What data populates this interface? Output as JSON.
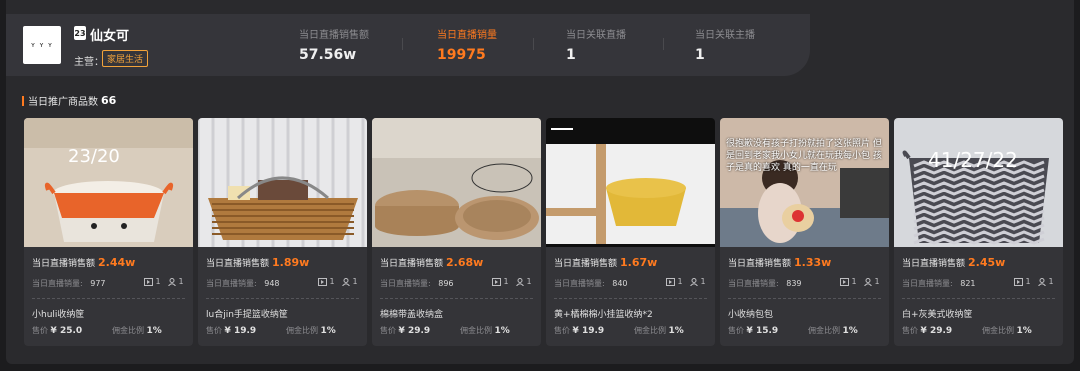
{
  "anchor": {
    "logo_text": "ʏ ʏ ʏ",
    "badge": "23",
    "name": "仙女可",
    "main_label": "主营：",
    "main_category": "家居生活"
  },
  "stats": [
    {
      "label": "当日直播销售额",
      "value": "57.56w",
      "active": false
    },
    {
      "label": "当日直播销量",
      "value": "19975",
      "active": true
    },
    {
      "label": "当日关联直播",
      "value": "1",
      "active": false
    },
    {
      "label": "当日关联主播",
      "value": "1",
      "active": false
    }
  ],
  "section": {
    "title": "当日推广商品数",
    "count": "66"
  },
  "card_labels": {
    "sales": "当日直播销售额",
    "volume": "当日直播销量:",
    "price": "售价",
    "commission": "佣金比例"
  },
  "products": [
    {
      "sales": "2.44w",
      "volume": "977",
      "live": "1",
      "anchors": "1",
      "name": "小huli收纳筐",
      "price": "¥ 25.0",
      "commission": "1%",
      "image_text": "23/20"
    },
    {
      "sales": "1.89w",
      "volume": "948",
      "live": "1",
      "anchors": "1",
      "name": "lu合jin手提篮收纳筐",
      "price": "¥ 19.9",
      "commission": "1%",
      "image_text": ""
    },
    {
      "sales": "2.68w",
      "volume": "896",
      "live": "1",
      "anchors": "1",
      "name": "棉棉带盖收纳盒",
      "price": "¥ 29.9",
      "commission": "1%",
      "image_text": ""
    },
    {
      "sales": "1.67w",
      "volume": "840",
      "live": "1",
      "anchors": "1",
      "name": "黄+橘棉棉小挂篮收纳*2",
      "price": "¥ 19.9",
      "commission": "1%",
      "image_text": ""
    },
    {
      "sales": "1.33w",
      "volume": "839",
      "live": "1",
      "anchors": "1",
      "name": "小收纳包包",
      "price": "¥ 15.9",
      "commission": "1%",
      "image_text": "很抱歉没有孩子打扮就拍了这张照片 但是回到老家我小女儿就在玩我每小包 孩子是真的喜欢 真的一直在玩"
    },
    {
      "sales": "2.45w",
      "volume": "821",
      "live": "1",
      "anchors": "1",
      "name": "白+灰美式收纳筐",
      "price": "¥ 29.9",
      "commission": "1%",
      "image_text": "41/27/22"
    }
  ],
  "colors": {
    "accent": "#ff7a1f",
    "bg": "#2a2a2d",
    "card": "#343438"
  }
}
